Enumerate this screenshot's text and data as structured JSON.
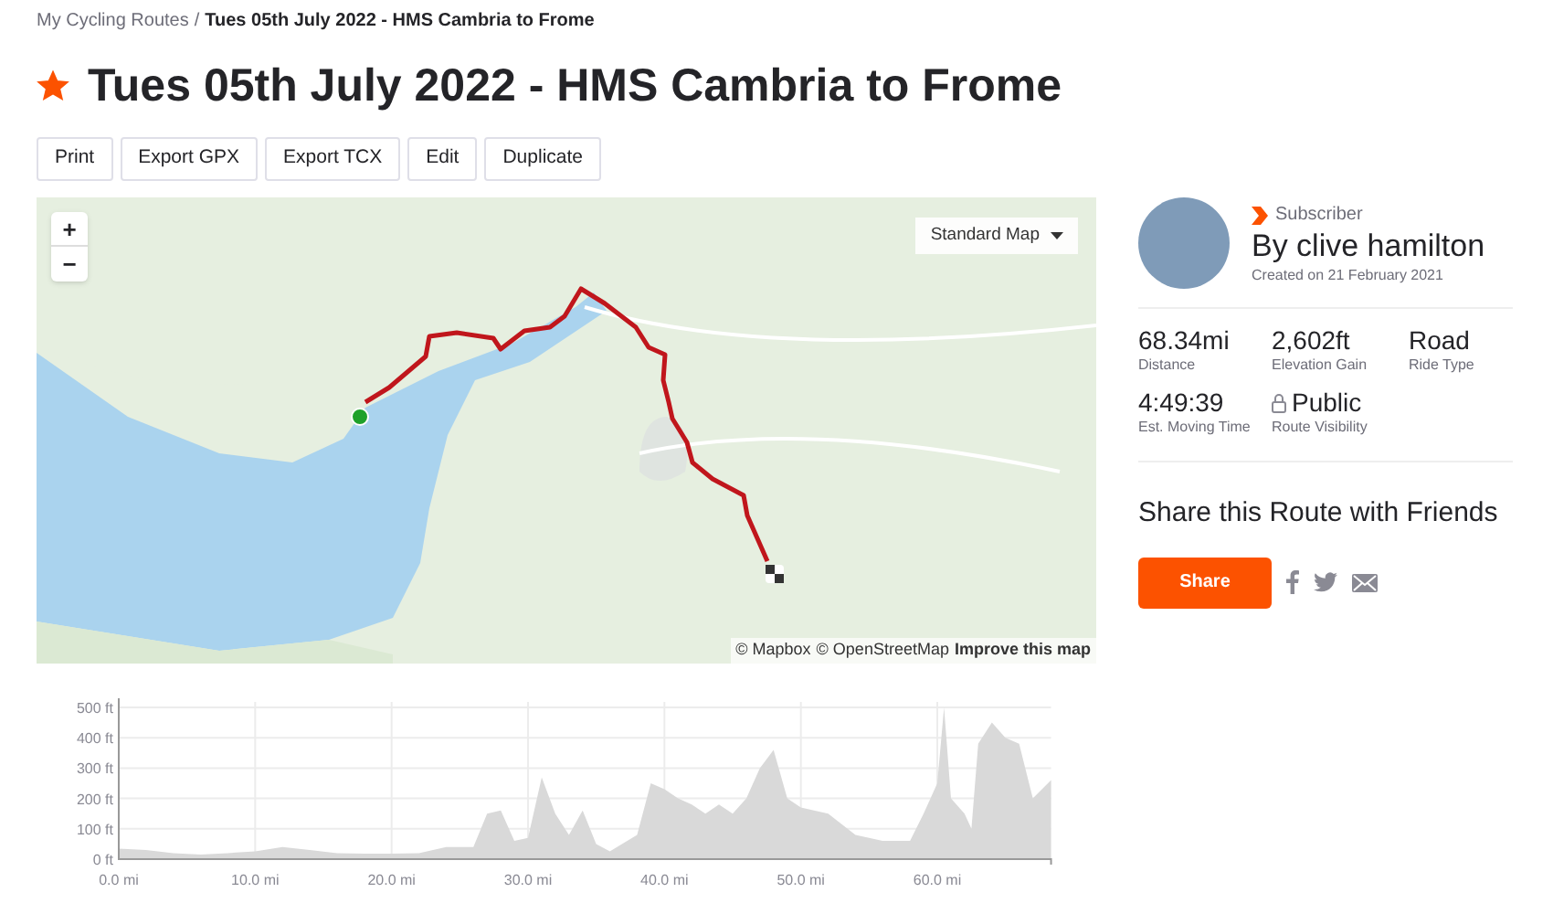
{
  "breadcrumb": {
    "parent": "My Cycling Routes",
    "separator": "/",
    "current": "Tues 05th July 2022 - HMS Cambria to Frome"
  },
  "title": {
    "text": "Tues 05th July 2022 - HMS Cambria to Frome",
    "starred": true
  },
  "actions": [
    "Print",
    "Export GPX",
    "Export TCX",
    "Edit",
    "Duplicate"
  ],
  "map": {
    "zoom_in": "+",
    "zoom_out": "−",
    "style_select": "Standard Map",
    "attribution": [
      {
        "text": "© Mapbox",
        "kind": "plain"
      },
      {
        "text": "© OpenStreetMap",
        "kind": "plain"
      },
      {
        "text": "Improve this map",
        "kind": "link"
      }
    ]
  },
  "author": {
    "badge": "Subscriber",
    "name": "By clive hamilton",
    "created": "Created on 21 February 2021"
  },
  "stats": [
    {
      "value": "68.34mi",
      "label": "Distance",
      "kind": "plain"
    },
    {
      "value": "2,602ft",
      "label": "Elevation Gain",
      "kind": "plain"
    },
    {
      "value": "Road",
      "label": "Ride Type",
      "kind": "plain"
    },
    {
      "value": "4:49:39",
      "label": "Est. Moving Time",
      "kind": "plain"
    },
    {
      "value": "Public",
      "label": "Route Visibility",
      "kind": "lock"
    }
  ],
  "share": {
    "heading": "Share this Route with Friends",
    "button": "Share"
  },
  "elevation": {
    "chart_data": {
      "type": "area",
      "x": [
        0,
        2,
        4,
        6,
        8,
        10,
        12,
        14,
        16,
        18,
        20,
        22,
        24,
        26,
        27,
        28,
        29,
        30,
        31,
        32,
        33,
        34,
        35,
        36,
        38,
        39,
        40,
        41,
        42,
        43,
        44,
        45,
        46,
        47,
        48,
        49,
        50,
        52,
        54,
        56,
        58,
        59,
        60,
        60.5,
        61,
        62,
        62.5,
        63,
        64,
        65,
        66,
        67,
        68.34
      ],
      "grid": true,
      "series": [
        {
          "color": "#d9d9d9",
          "values": [
            35,
            30,
            20,
            15,
            20,
            25,
            40,
            30,
            20,
            18,
            18,
            20,
            40,
            40,
            150,
            160,
            60,
            70,
            270,
            150,
            80,
            160,
            50,
            25,
            80,
            250,
            230,
            200,
            180,
            150,
            180,
            150,
            200,
            300,
            360,
            200,
            170,
            150,
            80,
            60,
            60,
            150,
            250,
            500,
            200,
            150,
            100,
            380,
            450,
            400,
            380,
            200,
            260
          ]
        }
      ],
      "xlim": [
        0,
        68.34
      ],
      "ylim": [
        0,
        500
      ],
      "xticks": [
        {
          "value": 0,
          "label": "0.0 mi"
        },
        {
          "value": 10,
          "label": "10.0 mi"
        },
        {
          "value": 20,
          "label": "20.0 mi"
        },
        {
          "value": 30,
          "label": "30.0 mi"
        },
        {
          "value": 40,
          "label": "40.0 mi"
        },
        {
          "value": 50,
          "label": "50.0 mi"
        },
        {
          "value": 60,
          "label": "60.0 mi"
        }
      ],
      "yticks": [
        {
          "value": 0,
          "label": "0 ft"
        },
        {
          "value": 100,
          "label": "100 ft"
        },
        {
          "value": 200,
          "label": "200 ft"
        },
        {
          "value": 300,
          "label": "300 ft"
        },
        {
          "value": 400,
          "label": "400 ft"
        },
        {
          "value": 500,
          "label": "500 ft"
        }
      ]
    }
  }
}
